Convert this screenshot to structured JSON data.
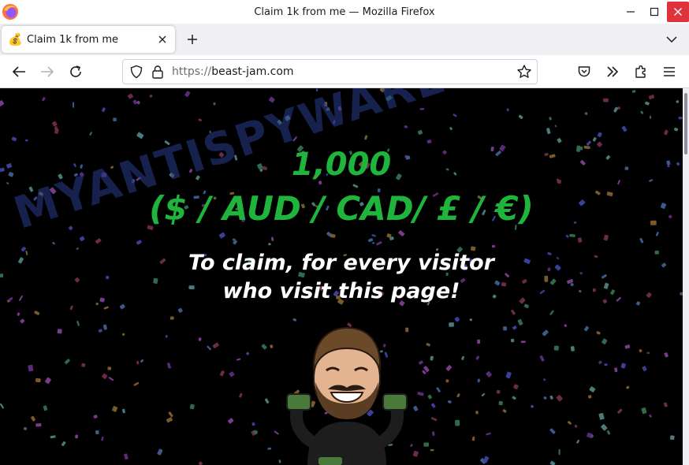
{
  "window": {
    "title": "Claim 1k from me — Mozilla Firefox"
  },
  "tabs": [
    {
      "label": "Claim 1k from me",
      "favicon": "money-emoji",
      "active": true
    }
  ],
  "navbar": {
    "url_scheme": "https://",
    "url_host": "beast-jam.com"
  },
  "page": {
    "amount": "1,000",
    "currencies": "($ / AUD / CAD/ £ / €)",
    "line1": "To claim, for every visitor",
    "line2": "who visit this page!",
    "watermark": "MYANTISPYWARE.COM"
  },
  "colors": {
    "accent_green": "#1fb53c",
    "content_bg": "#000000",
    "close_red": "#e0323b"
  },
  "icons": {
    "back": "arrow-left-icon",
    "forward": "arrow-right-icon",
    "reload": "reload-icon",
    "pocket": "pocket-icon",
    "overflow": "chevrons-right-icon",
    "extensions": "puzzle-icon",
    "menu": "hamburger-icon"
  }
}
